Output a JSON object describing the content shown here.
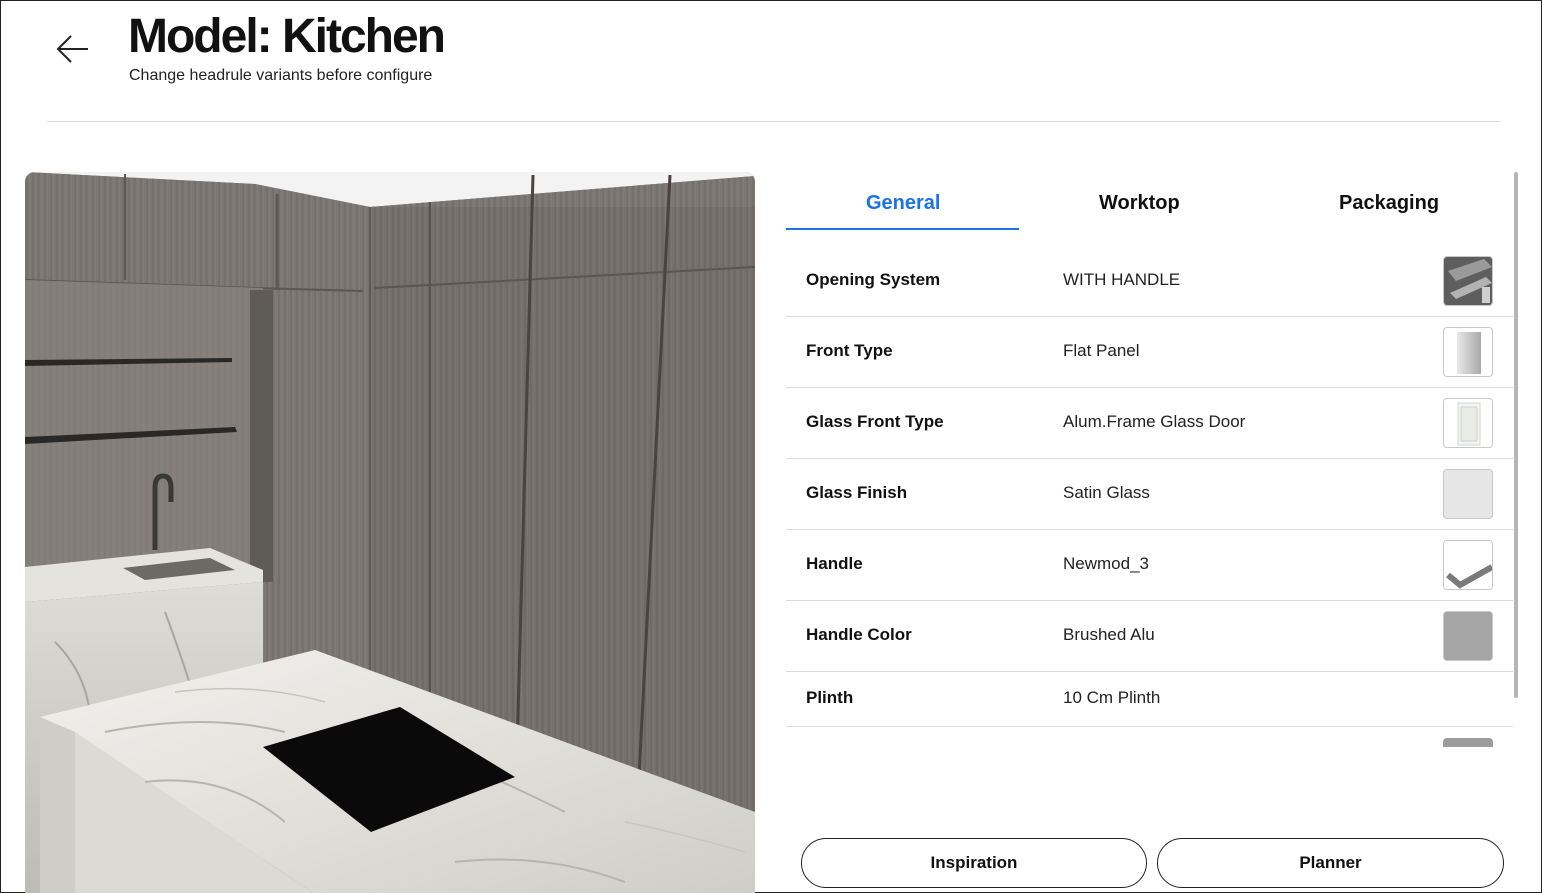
{
  "header": {
    "title": "Model: Kitchen",
    "subtitle": "Change headrule variants before configure",
    "back_icon": "arrow-left-icon"
  },
  "tabs": [
    {
      "label": "General",
      "active": true
    },
    {
      "label": "Worktop",
      "active": false
    },
    {
      "label": "Packaging",
      "active": false
    }
  ],
  "options": [
    {
      "label": "Opening System",
      "value": "WITH HANDLE",
      "swatch": "handle-profile-thumbnail"
    },
    {
      "label": "Front Type",
      "value": "Flat Panel",
      "swatch": "flat-panel-thumbnail"
    },
    {
      "label": "Glass Front Type",
      "value": "Alum.Frame Glass Door",
      "swatch": "glass-door-thumbnail"
    },
    {
      "label": "Glass Finish",
      "value": "Satin Glass",
      "swatch": "satin-glass-swatch",
      "color": "#e6e6e6"
    },
    {
      "label": "Handle",
      "value": "Newmod_3",
      "swatch": "handle-thumbnail"
    },
    {
      "label": "Handle Color",
      "value": "Brushed Alu",
      "swatch": "brushed-alu-swatch",
      "color": "#a5a5a5"
    },
    {
      "label": "Plinth",
      "value": "10 Cm Plinth"
    }
  ],
  "actions": {
    "inspiration": "Inspiration",
    "planner": "Planner"
  },
  "colors": {
    "accent": "#1a73e8",
    "cabinet_wood": "#7a7570",
    "marble": "#e9e7e2",
    "cooktop": "#0a0a0a"
  }
}
